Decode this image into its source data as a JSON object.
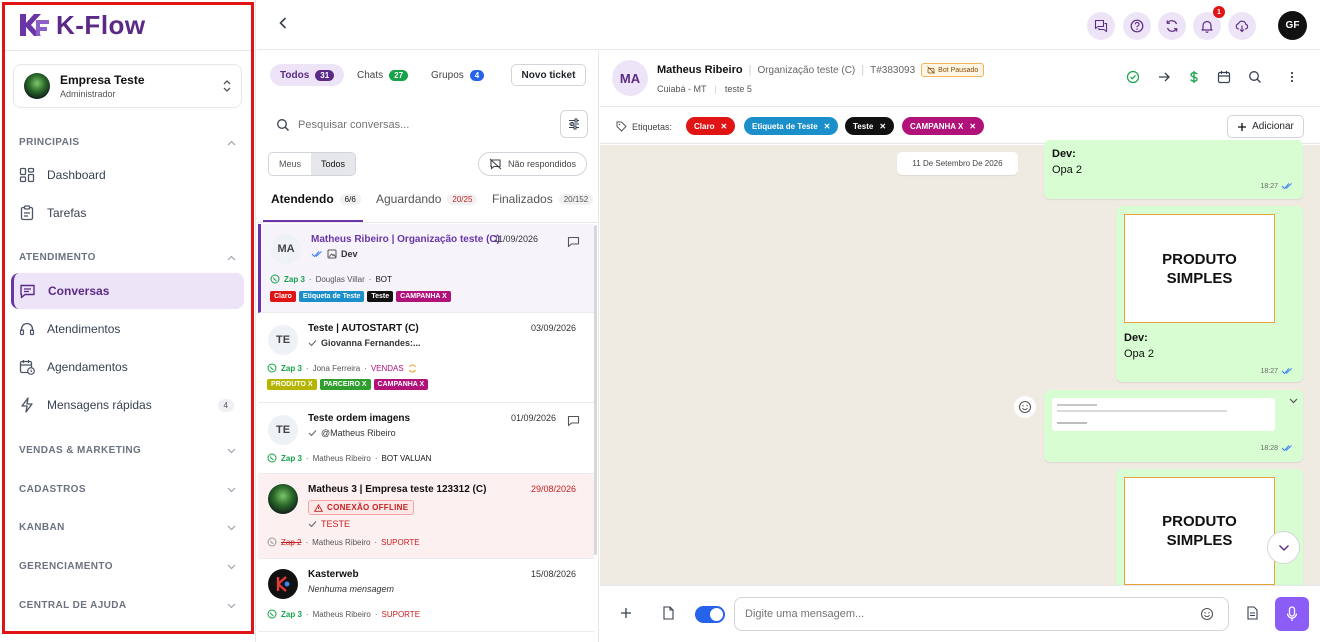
{
  "brand": {
    "name": "K-Flow",
    "mark": "KF"
  },
  "org": {
    "name": "Empresa Teste",
    "role": "Administrador"
  },
  "sidebar": {
    "sections": {
      "principais": "PRINCIPAIS",
      "atendimento": "ATENDIMENTO",
      "vendas": "VENDAS & MARKETING",
      "cadastros": "CADASTROS",
      "kanban": "KANBAN",
      "gerenciamento": "GERENCIAMENTO",
      "ajuda": "CENTRAL DE AJUDA"
    },
    "items": {
      "dashboard": "Dashboard",
      "tarefas": "Tarefas",
      "conversas": "Conversas",
      "atendimentos": "Atendimentos",
      "agendamentos": "Agendamentos",
      "mensagens": "Mensagens rápidas",
      "mensagens_badge": "4"
    }
  },
  "topbar": {
    "notifications": "1",
    "user_initials": "GF"
  },
  "list": {
    "tabs": {
      "todos": {
        "label": "Todos",
        "count": "31"
      },
      "chats": {
        "label": "Chats",
        "count": "27"
      },
      "grupos": {
        "label": "Grupos",
        "count": "4"
      }
    },
    "new_ticket": "Novo ticket",
    "search_placeholder": "Pesquisar conversas...",
    "seg": {
      "meus": "Meus",
      "todos": "Todos"
    },
    "nao_respondidos": "Não respondidos",
    "status_tabs": {
      "atendendo": {
        "label": "Atendendo",
        "count": "6/6"
      },
      "aguardando": {
        "label": "Aguardando",
        "count": "20/25"
      },
      "finalizados": {
        "label": "Finalizados",
        "count": "20/152"
      }
    },
    "conversations": [
      {
        "initials": "MA",
        "title": "Matheus Ribeiro | Organização teste (C)",
        "date": "11/09/2026",
        "last": "Dev",
        "channel": "Zap 3",
        "agent": "Douglas Villar",
        "queue": "BOT",
        "tags": [
          "Claro",
          "Etiqueta de Teste",
          "Teste",
          "CAMPANHA X"
        ]
      },
      {
        "initials": "TE",
        "title": "Teste | AUTOSTART (C)",
        "date": "03/09/2026",
        "last": "Giovanna Fernandes:...",
        "channel": "Zap 3",
        "agent": "Jona Ferreira",
        "queue": "VENDAS",
        "tags": [
          "PRODUTO X",
          "PARCEIRO X",
          "CAMPANHA X"
        ]
      },
      {
        "initials": "TE",
        "title": "Teste ordem imagens",
        "date": "01/09/2026",
        "last": "@Matheus Ribeiro",
        "channel": "Zap 3",
        "agent": "Matheus Ribeiro",
        "queue": "BOT VALUAN"
      },
      {
        "title": "Matheus 3 | Empresa teste 123312 (C)",
        "date": "29/08/2026",
        "badge": "CONEXÃO OFFLINE",
        "last": "TESTE",
        "channel": "Zap 2",
        "agent": "Matheus Ribeiro",
        "queue": "SUPORTE"
      },
      {
        "title": "Kasterweb",
        "date": "15/08/2026",
        "last": "Nenhuma mensagem",
        "channel": "Zap 3",
        "agent": "Matheus Ribeiro",
        "queue": "SUPORTE"
      }
    ]
  },
  "chat": {
    "initials": "MA",
    "contact": "Matheus Ribeiro",
    "org": "Organização teste (C)",
    "ticket": "T#383093",
    "bot_status": "Bot Pausado",
    "city": "Cuiabá - MT",
    "extra": "teste 5",
    "labels_title": "Etiquetas:",
    "labels": [
      "Claro",
      "Etiqueta de Teste",
      "Teste",
      "CAMPANHA X"
    ],
    "add_label": "Adicionar",
    "date_chip": "11 De Setembro De 2026",
    "messages": [
      {
        "sender": "Dev:",
        "text": "Opa 2",
        "time": "18:27"
      },
      {
        "image_text": "PRODUTO SIMPLES",
        "sender": "Dev:",
        "text": "Opa 2",
        "time": "18:27"
      },
      {
        "time": "18:28"
      },
      {
        "image_text": "PRODUTO SIMPLES"
      }
    ],
    "input_placeholder": "Digite uma mensagem..."
  },
  "colors": {
    "brand": "#5b2a86",
    "accent": "#6b35a8",
    "claro": "#e01414",
    "etiqueta": "#1b8fc9",
    "teste": "#111111",
    "campanha": "#b0127a",
    "produto": "#b5b500",
    "parceiro": "#2f9e2f",
    "vendas": "#b0127a"
  }
}
